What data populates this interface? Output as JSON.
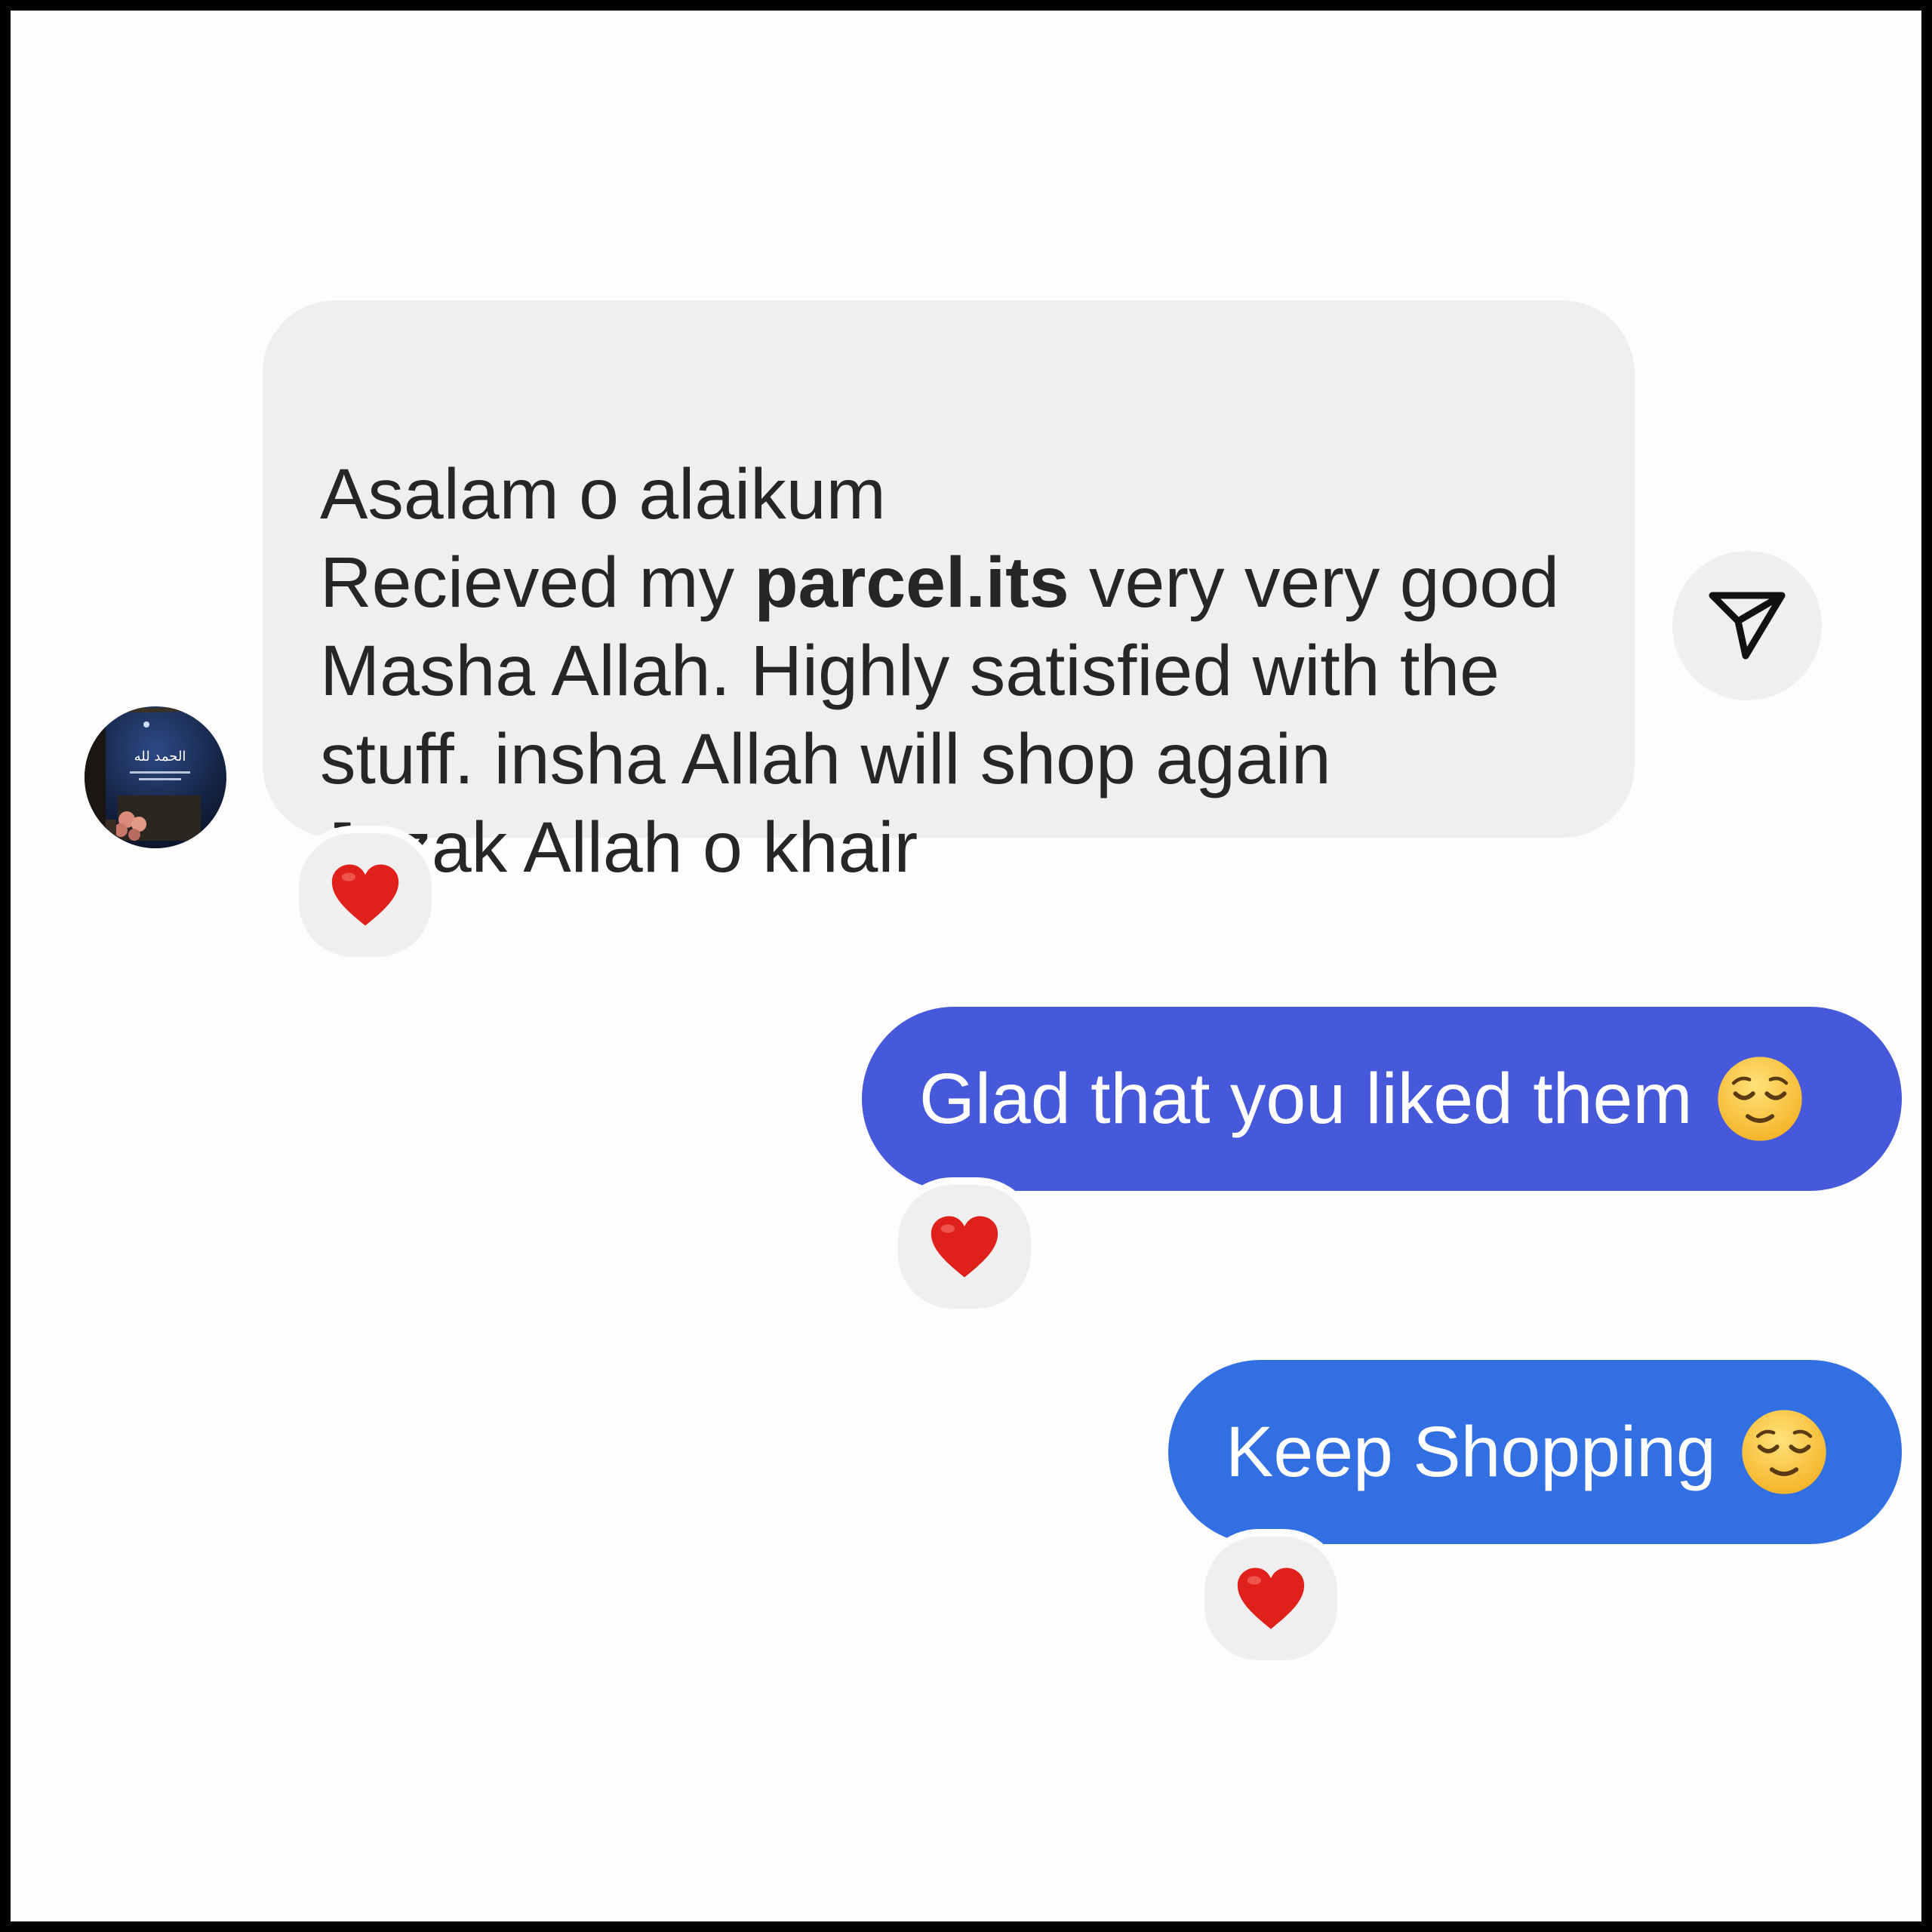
{
  "conversation": {
    "incoming": {
      "avatar": {
        "icon": "profile-photo",
        "text": "الحمد لله"
      },
      "message": {
        "line1": "Asalam o alaikum",
        "line2_before": "Recieved my ",
        "line2_bold": "parcel.its",
        "line2_after": " very very good",
        "line3": "Masha Allah. Highly satisfied with the",
        "line4": "stuff. insha Allah will shop again",
        "line5": "Jazak Allah o khair"
      },
      "reaction": "❤️",
      "share_icon": "send-icon"
    },
    "outgoing": [
      {
        "text": "Glad that you liked them",
        "emoji": "😌",
        "reaction": "❤️",
        "color": "#4659db"
      },
      {
        "text": "Keep Shopping",
        "emoji": "😌",
        "reaction": "❤️",
        "color": "#316fe3"
      }
    ]
  },
  "colors": {
    "incoming_bubble": "#efefef",
    "incoming_text": "#262626",
    "outgoing_text": "#ffffff",
    "background": "#fdfdfd",
    "heart": "#e0201a"
  }
}
